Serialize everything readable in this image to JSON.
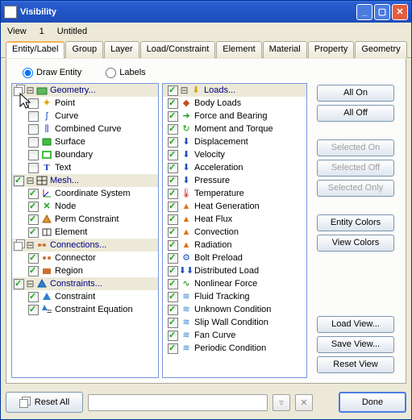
{
  "window": {
    "title": "Visibility"
  },
  "toprow": {
    "view": "View",
    "num": "1",
    "name": "Untitled"
  },
  "tabs": [
    "Entity/Label",
    "Group",
    "Layer",
    "Load/Constraint",
    "Element",
    "Material",
    "Property",
    "Geometry"
  ],
  "radios": {
    "draw": "Draw Entity",
    "labels": "Labels"
  },
  "groups": {
    "geometry": "Geometry...",
    "mesh": "Mesh...",
    "connections": "Connections...",
    "constraints": "Constraints...",
    "loads": "Loads..."
  },
  "left": {
    "point": "Point",
    "curve": "Curve",
    "combcurve": "Combined Curve",
    "surface": "Surface",
    "boundary": "Boundary",
    "text": "Text",
    "csys": "Coordinate System",
    "node": "Node",
    "permc": "Perm Constraint",
    "element": "Element",
    "connector": "Connector",
    "region": "Region",
    "constraint": "Constraint",
    "ceq": "Constraint Equation"
  },
  "mid": {
    "body": "Body Loads",
    "force": "Force and Bearing",
    "moment": "Moment and Torque",
    "disp": "Displacement",
    "vel": "Velocity",
    "accel": "Acceleration",
    "press": "Pressure",
    "temp": "Temperature",
    "heatgen": "Heat Generation",
    "heatflux": "Heat Flux",
    "conv": "Convection",
    "rad": "Radiation",
    "bolt": "Bolt Preload",
    "dist": "Distributed Load",
    "nlf": "Nonlinear Force",
    "fluid": "Fluid Tracking",
    "unk": "Unknown Condition",
    "slip": "Slip Wall Condition",
    "fan": "Fan Curve",
    "per": "Periodic Condition"
  },
  "buttons": {
    "allon": "All On",
    "alloff": "All Off",
    "selon": "Selected On",
    "seloff": "Selected Off",
    "selonly": "Selected Only",
    "ecolors": "Entity Colors",
    "vcolors": "View Colors",
    "loadv": "Load View...",
    "savev": "Save View...",
    "resetv": "Reset View",
    "resetall": "Reset All",
    "done": "Done"
  }
}
